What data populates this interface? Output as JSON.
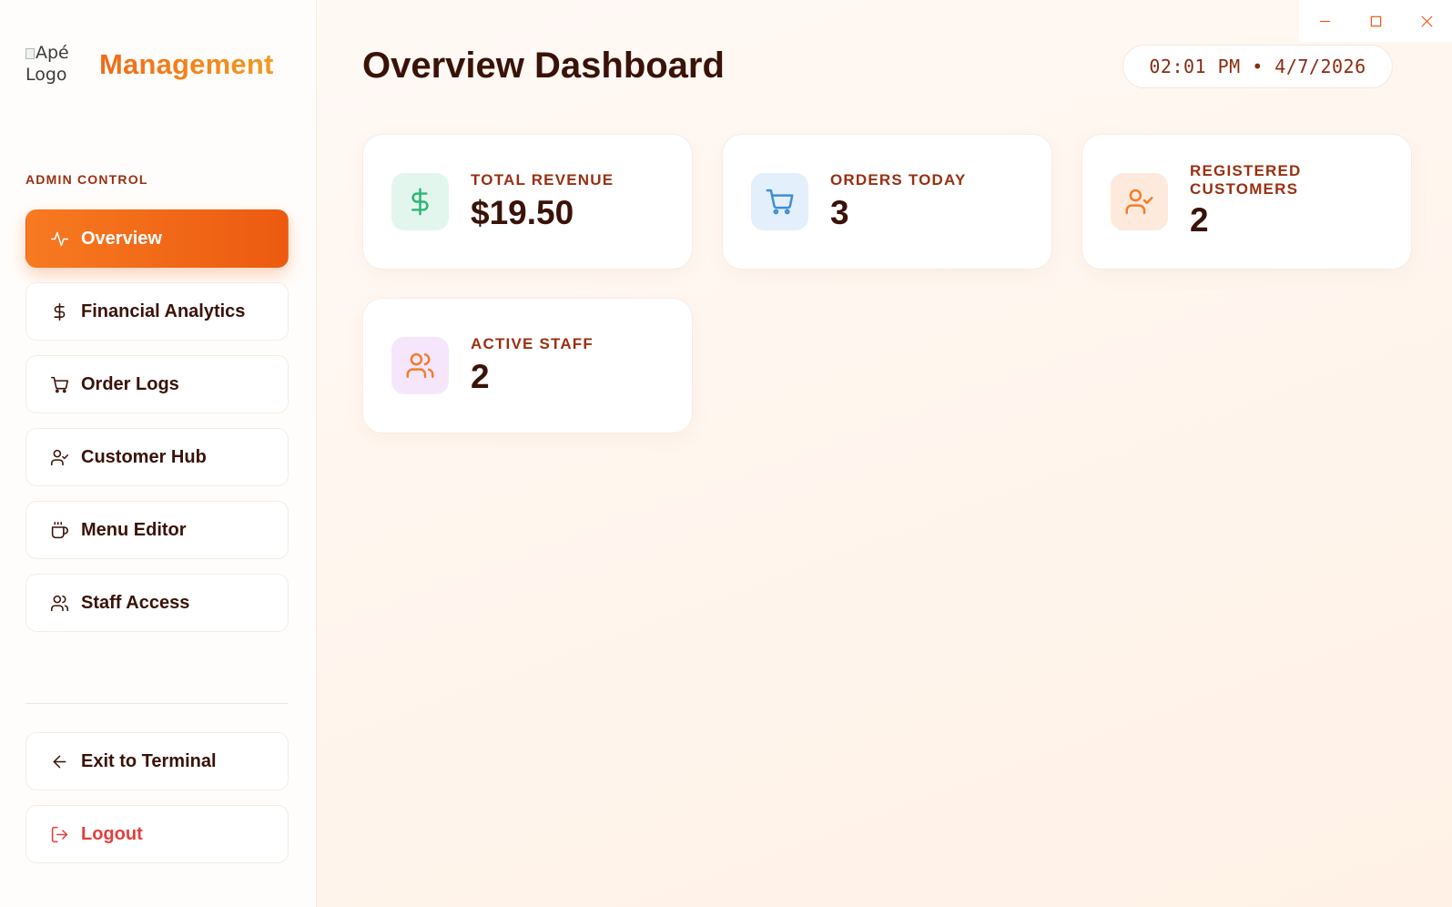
{
  "window_controls": {
    "minimize_icon": "minimize-icon",
    "maximize_icon": "maximize-icon",
    "close_icon": "close-icon"
  },
  "brand": {
    "logo_alt": "Apé Logo",
    "title": "Management"
  },
  "sidebar": {
    "section_label": "ADMIN CONTROL",
    "items": [
      {
        "label": "Overview",
        "icon": "activity-icon",
        "active": true
      },
      {
        "label": "Financial Analytics",
        "icon": "dollar-icon",
        "active": false
      },
      {
        "label": "Order Logs",
        "icon": "cart-icon",
        "active": false
      },
      {
        "label": "Customer Hub",
        "icon": "user-check-icon",
        "active": false
      },
      {
        "label": "Menu Editor",
        "icon": "coffee-icon",
        "active": false
      },
      {
        "label": "Staff Access",
        "icon": "users-icon",
        "active": false
      }
    ],
    "bottom_items": [
      {
        "label": "Exit to Terminal",
        "icon": "arrow-left-icon"
      },
      {
        "label": "Logout",
        "icon": "logout-icon"
      }
    ]
  },
  "main": {
    "title": "Overview Dashboard",
    "clock": "02:01 PM • 4/7/2026",
    "stats": [
      {
        "label": "TOTAL REVENUE",
        "value": "$19.50",
        "icon": "dollar-icon",
        "accent": "#2bb673",
        "bg": "#e3f6ee"
      },
      {
        "label": "ORDERS TODAY",
        "value": "3",
        "icon": "cart-icon",
        "accent": "#3d8fd6",
        "bg": "#e3effb"
      },
      {
        "label": "REGISTERED CUSTOMERS",
        "value": "2",
        "icon": "user-check-icon",
        "accent": "#f07d2c",
        "bg": "#fdeadc"
      },
      {
        "label": "ACTIVE STAFF",
        "value": "2",
        "icon": "users-icon",
        "accent": "#f07d2c",
        "bg": "#f6e6fb"
      }
    ]
  },
  "colors": {
    "primary": "#f06a1a",
    "text_dark": "#3a1208",
    "label_brown": "#9a2f12",
    "logout_red": "#e2403d"
  }
}
